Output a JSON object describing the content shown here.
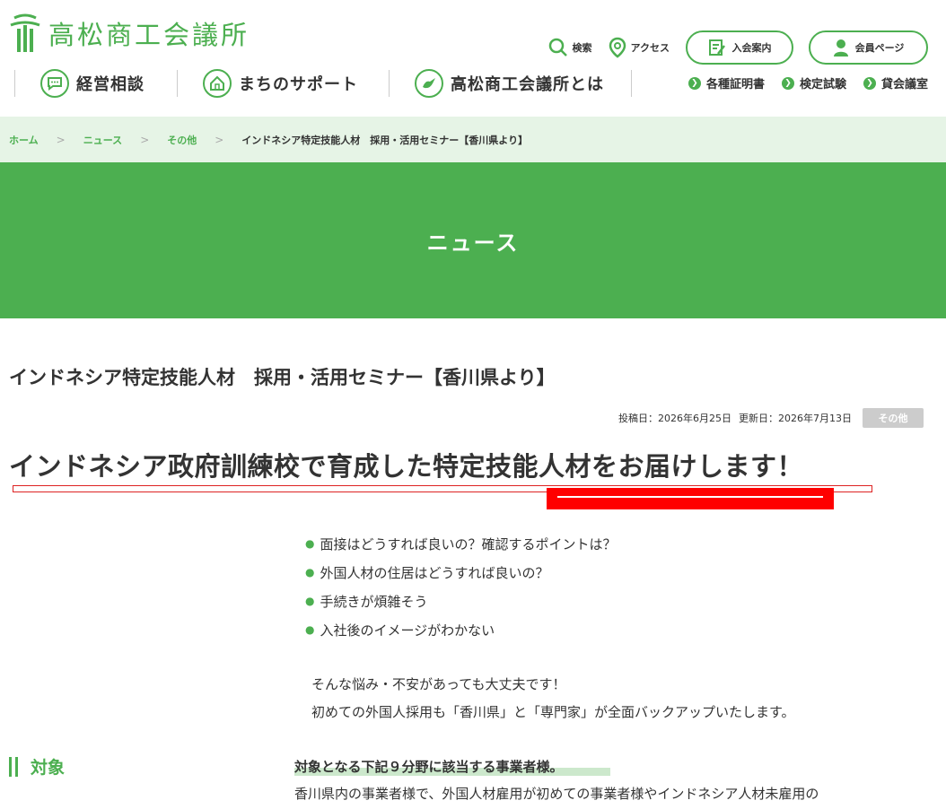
{
  "header": {
    "logo_text": "高松商工会議所",
    "util": {
      "search": "検索",
      "access": "アクセス",
      "join": "入会案内",
      "member": "会員ページ"
    },
    "gnav": [
      "経営相談",
      "まちのサポート",
      "高松商工会議所とは"
    ],
    "subnav": [
      "各種証明書",
      "検定試験",
      "貸会議室"
    ]
  },
  "breadcrumb": {
    "home": "ホーム",
    "news": "ニュース",
    "other": "その他",
    "sep": ">",
    "current": "インドネシア特定技能人材　採用・活用セミナー【香川県より】"
  },
  "banner": {
    "title": "ニュース"
  },
  "article": {
    "title": "インドネシア特定技能人材　採用・活用セミナー【香川県より】",
    "posted": "投稿日：2026年6月25日",
    "updated": "更新日：2026年7月13日",
    "category": "その他",
    "headline": "インドネシア政府訓練校で育成した特定技能人材をお届けします！",
    "concerns": [
      "面接はどうすれば良いの？確認するポイントは？",
      "外国人材の住居はどうすれば良いの？",
      "手続きが煩雑そう",
      "入社後のイメージがわかない"
    ],
    "reassure": [
      "そんな悩み・不安があっても大丈夫です！",
      "初めての外国人採用も「香川県」と「専門家」が全面バックアップいたします。"
    ],
    "section_title": "対象",
    "target_lead": "対象となる下記９分野に該当する事業者様。",
    "target_body": "香川県内の事業者様で、外国人材雇用が初めての事業者様やインドネシア人材未雇用の"
  },
  "colors": {
    "accent": "#4caf50",
    "highlight": "#ff0000",
    "breadcrumb_bg": "#e6f4e6"
  },
  "icons": [
    "logo-mark-icon",
    "search-icon",
    "map-pin-icon",
    "form-icon",
    "person-icon",
    "chat-bubble-icon",
    "house-icon",
    "bird-icon",
    "chevron-right-icon"
  ]
}
